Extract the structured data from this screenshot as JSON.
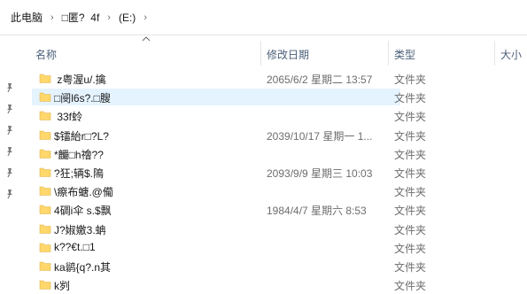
{
  "breadcrumb": {
    "items": [
      "此电脑",
      "□匿?  4f",
      "(E:)"
    ]
  },
  "columns": {
    "name": "名称",
    "date": "修改日期",
    "type": "类型",
    "size": "大小"
  },
  "rows": [
    {
      "name": " z粤渥u/.擒",
      "date": "2065/6/2 星期二 13:57",
      "type": "文件夹",
      "selected": false
    },
    {
      "name": "□阌l6s?.□膄",
      "date": "",
      "type": "文件夹",
      "selected": true
    },
    {
      "name": " 33f蛉",
      "date": "",
      "type": "文件夹",
      "selected": false
    },
    {
      "name": "$镭紿r□?L?",
      "date": "2039/10/17 星期一 1...",
      "type": "文件夹",
      "selected": false
    },
    {
      "name": "*麣□h禬??",
      "date": "",
      "type": "文件夹",
      "selected": false
    },
    {
      "name": "?狂;辆$.隝",
      "date": "2093/9/9 星期三 10:03",
      "type": "文件夹",
      "selected": false
    },
    {
      "name": "\\瘵布螗.@僃",
      "date": "",
      "type": "文件夹",
      "selected": false
    },
    {
      "name": "4碉i伞 s.$飘",
      "date": "1984/4/7 星期六 8:53",
      "type": "文件夹",
      "selected": false
    },
    {
      "name": "J?婌嬓3.蚺",
      "date": "",
      "type": "文件夹",
      "selected": false
    },
    {
      "name": "k??€t.□1",
      "date": "",
      "type": "文件夹",
      "selected": false
    },
    {
      "name": "ka鹟{q?.n其",
      "date": "",
      "type": "文件夹",
      "selected": false
    },
    {
      "name": "k刿",
      "date": "",
      "type": "文件夹",
      "selected": false
    }
  ],
  "colors": {
    "selected_bg": "#cce8ff",
    "folder_yellow": "#ffd76b",
    "header_text": "#4c607a"
  },
  "icons": {
    "breadcrumb_separator": "chevron-right-icon",
    "row_icon": "folder-icon",
    "quick_access": "pin-icon"
  }
}
